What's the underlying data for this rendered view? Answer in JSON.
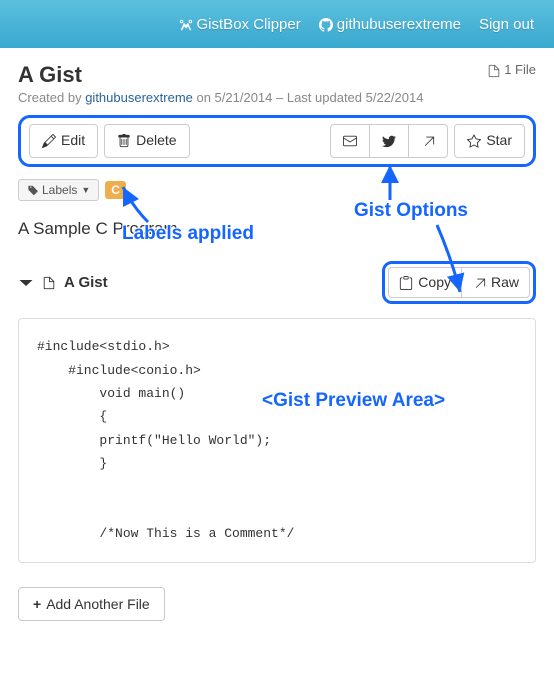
{
  "header": {
    "clipper": "GistBox Clipper",
    "username": "githubuserextreme",
    "signout": "Sign out"
  },
  "gist": {
    "title": "A Gist",
    "file_count": "1 File",
    "created_by_prefix": "Created by ",
    "author": "githubuserextreme",
    "created_date": " on 5/21/2014 – Last updated 5/22/2014",
    "description": "A Sample C Program"
  },
  "toolbar": {
    "edit": "Edit",
    "delete": "Delete",
    "star": "Star"
  },
  "labels": {
    "button": "Labels",
    "tag": "C"
  },
  "file": {
    "name": "A Gist",
    "copy": "Copy",
    "raw": "Raw",
    "code": "#include<stdio.h>\n    #include<conio.h>\n        void main()\n        {\n        printf(\"Hello World\");\n        }\n\n\n        /*Now This is a Comment*/"
  },
  "buttons": {
    "add_file": "Add Another File"
  },
  "annotations": {
    "labels_applied": "Labels applied",
    "gist_options": "Gist Options",
    "gist_preview": "<Gist Preview Area>"
  }
}
